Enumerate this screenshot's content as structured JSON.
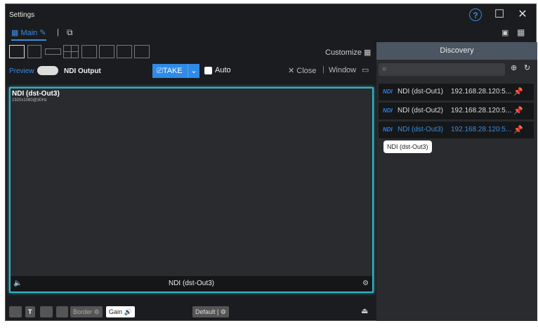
{
  "window": {
    "title": "Settings"
  },
  "tabs": [
    {
      "label": "Main"
    }
  ],
  "toolbar": {
    "customize": "Customize",
    "preview": "Preview",
    "ndi_output": "NDI Output",
    "take": "TAKE",
    "auto": "Auto",
    "close": "Close",
    "window": "Window"
  },
  "preview": {
    "source": "NDI (dst-Out3)",
    "resolution": "1920x1080@30Hz",
    "footer_label": "NDI (dst-Out3)"
  },
  "bottom": {
    "border": "Border",
    "gain": "Gain",
    "default": "Default"
  },
  "discovery": {
    "title": "Discovery",
    "search_placeholder": "",
    "items": [
      {
        "badge": "NDI",
        "name": "NDI (dst-Out1)",
        "ip": "192.168.28.120:5..."
      },
      {
        "badge": "NDI",
        "name": "NDI (dst-Out2)",
        "ip": "192.168.28.120:5..."
      },
      {
        "badge": "NDI",
        "name": "NDI (dst-Out3)",
        "ip": "192.168.28.120:5..."
      }
    ],
    "tooltip": "NDI (dst-Out3)"
  },
  "colors": {
    "accent": "#2f8be6",
    "preview_border": "#35b3c4"
  }
}
